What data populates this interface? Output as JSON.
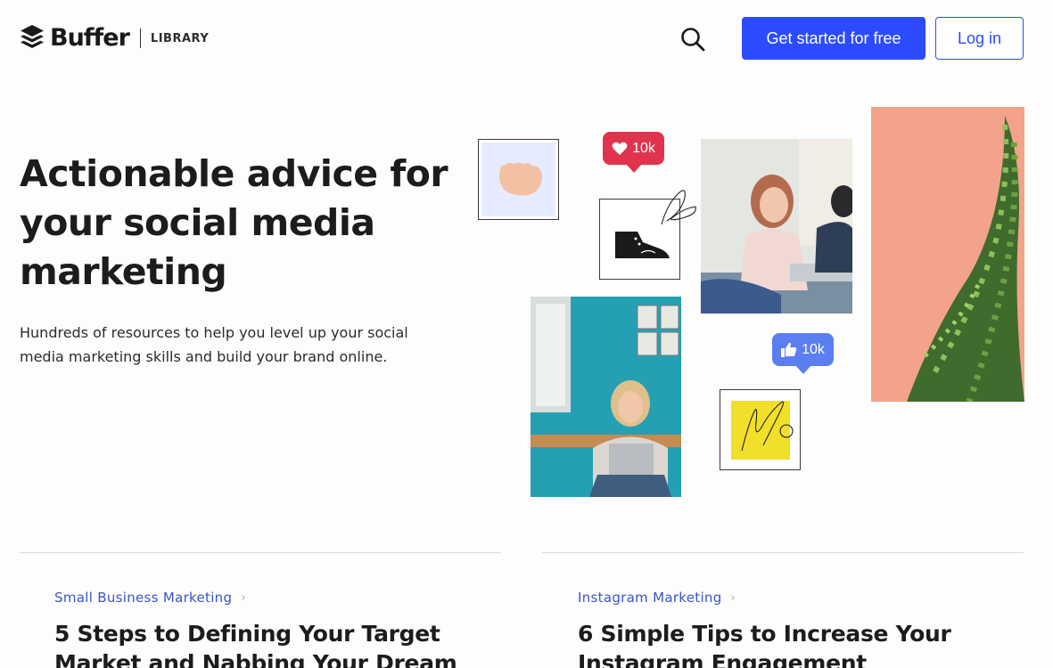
{
  "header": {
    "brand": "Buffer",
    "section": "LIBRARY",
    "cta_label": "Get started for free",
    "login_label": "Log in",
    "accent": "#2c4bff"
  },
  "hero": {
    "title": "Actionable advice for your social media marketing",
    "subtitle": "Hundreds of resources to help you level up your social media marketing skills and build your brand online."
  },
  "collage": {
    "likes_badge": "10k",
    "thumbs_badge": "10k",
    "likes_color": "#e0344e",
    "thumbs_color": "#5b7ff0"
  },
  "articles": [
    {
      "category": "Small Business Marketing",
      "title": "5 Steps to Defining Your Target Market and Nabbing Your Dream"
    },
    {
      "category": "Instagram Marketing",
      "title": "6 Simple Tips to Increase Your Instagram Engagement"
    }
  ]
}
